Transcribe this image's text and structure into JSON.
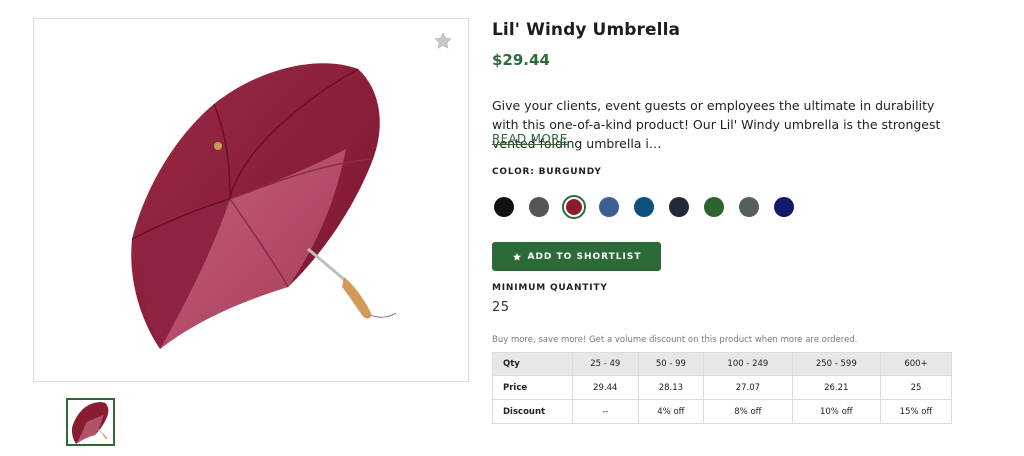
{
  "product": {
    "title": "Lil' Windy Umbrella",
    "price": "$29.44",
    "description": "Give your clients, event guests or employees the ultimate in durability with this one-of-a-kind product! Our Lil' Windy umbrella is the strongest vented folding umbrella i…",
    "read_more": "READ MORE"
  },
  "gallery": {
    "favorite_icon": "star-icon",
    "thumbnail_alt": "burgundy umbrella thumbnail"
  },
  "color": {
    "label": "COLOR: BURGUNDY",
    "swatches": [
      {
        "name": "black",
        "hex": "#111111",
        "selected": false
      },
      {
        "name": "gray",
        "hex": "#555555",
        "selected": false
      },
      {
        "name": "burgundy",
        "hex": "#8a1c32",
        "selected": true
      },
      {
        "name": "slate-blue",
        "hex": "#3c5f94",
        "selected": false
      },
      {
        "name": "teal-blue",
        "hex": "#0d4f7d",
        "selected": false
      },
      {
        "name": "charcoal-navy",
        "hex": "#242838",
        "selected": false
      },
      {
        "name": "forest-green",
        "hex": "#2e6331",
        "selected": false
      },
      {
        "name": "dark-gray-green",
        "hex": "#56615d",
        "selected": false
      },
      {
        "name": "navy",
        "hex": "#131a6e",
        "selected": false
      }
    ]
  },
  "actions": {
    "shortlist_label": "ADD TO SHORTLIST",
    "shortlist_icon": "star-icon"
  },
  "quantity": {
    "label": "MINIMUM QUANTITY",
    "value": "25"
  },
  "volume": {
    "note": "Buy more, save more! Get a volume discount on this product when more are ordered.",
    "headers": [
      "Qty",
      "25 - 49",
      "50 - 99",
      "100 - 249",
      "250 - 599",
      "600+"
    ],
    "rows": [
      [
        "Price",
        "29.44",
        "28.13",
        "27.07",
        "26.21",
        "25"
      ],
      [
        "Discount",
        "--",
        "4% off",
        "8% off",
        "10% off",
        "15% off"
      ]
    ]
  },
  "colors": {
    "accent": "#2d6a3a",
    "table_header_bg": "#e6e8e6"
  }
}
